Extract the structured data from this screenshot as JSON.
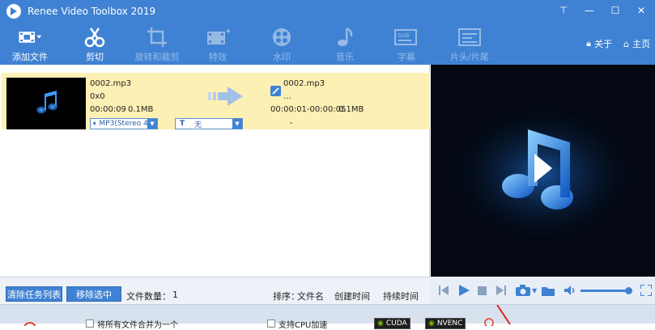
{
  "window": {
    "title": "Renee Video Toolbox 2019",
    "controls": {
      "menu": "⊤",
      "minimize": "—",
      "maximize": "☐",
      "close": "✕"
    }
  },
  "toolbar": {
    "items": [
      {
        "label": "添加文件",
        "icon": "film-add-icon"
      },
      {
        "label": "剪切",
        "icon": "scissors-icon"
      },
      {
        "label": "旋转和裁剪",
        "icon": "crop-icon"
      },
      {
        "label": "特效",
        "icon": "effects-icon"
      },
      {
        "label": "水印",
        "icon": "watermark-icon"
      },
      {
        "label": "音乐",
        "icon": "music-icon"
      },
      {
        "label": "字幕",
        "icon": "subtitle-icon"
      },
      {
        "label": "片头/片尾",
        "icon": "intro-outro-icon"
      }
    ],
    "about": "关于",
    "home": "主页"
  },
  "file": {
    "source": {
      "name": "0002.mp3",
      "res": "0x0",
      "duration": "00:00:09",
      "size": "0.1MB"
    },
    "output": {
      "name": "0002.mp3",
      "res": "...",
      "range": "00:00:01-00:00:05",
      "size": "0.1MB"
    },
    "audio_track": "MP3(Stereo 4",
    "subtitle": "无",
    "dash": "-"
  },
  "bottom": {
    "clear_btn": "清除任务列表",
    "remove_btn": "移除选中",
    "count_label": "文件数量：",
    "count": "1",
    "sort_label": "排序：",
    "sort_name": "文件名",
    "sort_created": "创建时间",
    "sort_duration": "持续时间"
  },
  "footer": {
    "merge": "将所有文件合并为一个",
    "cpu": "支持CPU加速",
    "cuda": "CUDA",
    "nvenc": "NVENC"
  },
  "colors": {
    "accent": "#3f82d3",
    "row_highlight": "#fcf0b4"
  }
}
